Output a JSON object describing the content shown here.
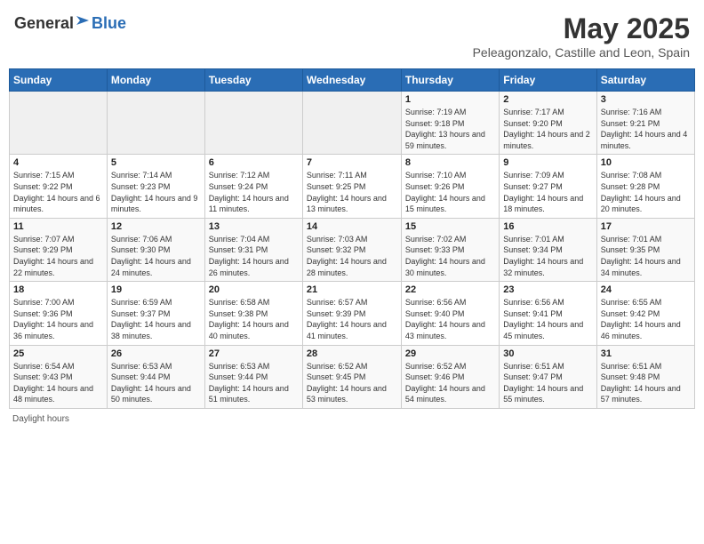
{
  "header": {
    "logo_general": "General",
    "logo_blue": "Blue",
    "month_title": "May 2025",
    "subtitle": "Peleagonzalo, Castille and Leon, Spain"
  },
  "days_of_week": [
    "Sunday",
    "Monday",
    "Tuesday",
    "Wednesday",
    "Thursday",
    "Friday",
    "Saturday"
  ],
  "weeks": [
    [
      {
        "day": "",
        "sunrise": "",
        "sunset": "",
        "daylight": ""
      },
      {
        "day": "",
        "sunrise": "",
        "sunset": "",
        "daylight": ""
      },
      {
        "day": "",
        "sunrise": "",
        "sunset": "",
        "daylight": ""
      },
      {
        "day": "",
        "sunrise": "",
        "sunset": "",
        "daylight": ""
      },
      {
        "day": "1",
        "sunrise": "Sunrise: 7:19 AM",
        "sunset": "Sunset: 9:18 PM",
        "daylight": "Daylight: 13 hours and 59 minutes."
      },
      {
        "day": "2",
        "sunrise": "Sunrise: 7:17 AM",
        "sunset": "Sunset: 9:20 PM",
        "daylight": "Daylight: 14 hours and 2 minutes."
      },
      {
        "day": "3",
        "sunrise": "Sunrise: 7:16 AM",
        "sunset": "Sunset: 9:21 PM",
        "daylight": "Daylight: 14 hours and 4 minutes."
      }
    ],
    [
      {
        "day": "4",
        "sunrise": "Sunrise: 7:15 AM",
        "sunset": "Sunset: 9:22 PM",
        "daylight": "Daylight: 14 hours and 6 minutes."
      },
      {
        "day": "5",
        "sunrise": "Sunrise: 7:14 AM",
        "sunset": "Sunset: 9:23 PM",
        "daylight": "Daylight: 14 hours and 9 minutes."
      },
      {
        "day": "6",
        "sunrise": "Sunrise: 7:12 AM",
        "sunset": "Sunset: 9:24 PM",
        "daylight": "Daylight: 14 hours and 11 minutes."
      },
      {
        "day": "7",
        "sunrise": "Sunrise: 7:11 AM",
        "sunset": "Sunset: 9:25 PM",
        "daylight": "Daylight: 14 hours and 13 minutes."
      },
      {
        "day": "8",
        "sunrise": "Sunrise: 7:10 AM",
        "sunset": "Sunset: 9:26 PM",
        "daylight": "Daylight: 14 hours and 15 minutes."
      },
      {
        "day": "9",
        "sunrise": "Sunrise: 7:09 AM",
        "sunset": "Sunset: 9:27 PM",
        "daylight": "Daylight: 14 hours and 18 minutes."
      },
      {
        "day": "10",
        "sunrise": "Sunrise: 7:08 AM",
        "sunset": "Sunset: 9:28 PM",
        "daylight": "Daylight: 14 hours and 20 minutes."
      }
    ],
    [
      {
        "day": "11",
        "sunrise": "Sunrise: 7:07 AM",
        "sunset": "Sunset: 9:29 PM",
        "daylight": "Daylight: 14 hours and 22 minutes."
      },
      {
        "day": "12",
        "sunrise": "Sunrise: 7:06 AM",
        "sunset": "Sunset: 9:30 PM",
        "daylight": "Daylight: 14 hours and 24 minutes."
      },
      {
        "day": "13",
        "sunrise": "Sunrise: 7:04 AM",
        "sunset": "Sunset: 9:31 PM",
        "daylight": "Daylight: 14 hours and 26 minutes."
      },
      {
        "day": "14",
        "sunrise": "Sunrise: 7:03 AM",
        "sunset": "Sunset: 9:32 PM",
        "daylight": "Daylight: 14 hours and 28 minutes."
      },
      {
        "day": "15",
        "sunrise": "Sunrise: 7:02 AM",
        "sunset": "Sunset: 9:33 PM",
        "daylight": "Daylight: 14 hours and 30 minutes."
      },
      {
        "day": "16",
        "sunrise": "Sunrise: 7:01 AM",
        "sunset": "Sunset: 9:34 PM",
        "daylight": "Daylight: 14 hours and 32 minutes."
      },
      {
        "day": "17",
        "sunrise": "Sunrise: 7:01 AM",
        "sunset": "Sunset: 9:35 PM",
        "daylight": "Daylight: 14 hours and 34 minutes."
      }
    ],
    [
      {
        "day": "18",
        "sunrise": "Sunrise: 7:00 AM",
        "sunset": "Sunset: 9:36 PM",
        "daylight": "Daylight: 14 hours and 36 minutes."
      },
      {
        "day": "19",
        "sunrise": "Sunrise: 6:59 AM",
        "sunset": "Sunset: 9:37 PM",
        "daylight": "Daylight: 14 hours and 38 minutes."
      },
      {
        "day": "20",
        "sunrise": "Sunrise: 6:58 AM",
        "sunset": "Sunset: 9:38 PM",
        "daylight": "Daylight: 14 hours and 40 minutes."
      },
      {
        "day": "21",
        "sunrise": "Sunrise: 6:57 AM",
        "sunset": "Sunset: 9:39 PM",
        "daylight": "Daylight: 14 hours and 41 minutes."
      },
      {
        "day": "22",
        "sunrise": "Sunrise: 6:56 AM",
        "sunset": "Sunset: 9:40 PM",
        "daylight": "Daylight: 14 hours and 43 minutes."
      },
      {
        "day": "23",
        "sunrise": "Sunrise: 6:56 AM",
        "sunset": "Sunset: 9:41 PM",
        "daylight": "Daylight: 14 hours and 45 minutes."
      },
      {
        "day": "24",
        "sunrise": "Sunrise: 6:55 AM",
        "sunset": "Sunset: 9:42 PM",
        "daylight": "Daylight: 14 hours and 46 minutes."
      }
    ],
    [
      {
        "day": "25",
        "sunrise": "Sunrise: 6:54 AM",
        "sunset": "Sunset: 9:43 PM",
        "daylight": "Daylight: 14 hours and 48 minutes."
      },
      {
        "day": "26",
        "sunrise": "Sunrise: 6:53 AM",
        "sunset": "Sunset: 9:44 PM",
        "daylight": "Daylight: 14 hours and 50 minutes."
      },
      {
        "day": "27",
        "sunrise": "Sunrise: 6:53 AM",
        "sunset": "Sunset: 9:44 PM",
        "daylight": "Daylight: 14 hours and 51 minutes."
      },
      {
        "day": "28",
        "sunrise": "Sunrise: 6:52 AM",
        "sunset": "Sunset: 9:45 PM",
        "daylight": "Daylight: 14 hours and 53 minutes."
      },
      {
        "day": "29",
        "sunrise": "Sunrise: 6:52 AM",
        "sunset": "Sunset: 9:46 PM",
        "daylight": "Daylight: 14 hours and 54 minutes."
      },
      {
        "day": "30",
        "sunrise": "Sunrise: 6:51 AM",
        "sunset": "Sunset: 9:47 PM",
        "daylight": "Daylight: 14 hours and 55 minutes."
      },
      {
        "day": "31",
        "sunrise": "Sunrise: 6:51 AM",
        "sunset": "Sunset: 9:48 PM",
        "daylight": "Daylight: 14 hours and 57 minutes."
      }
    ]
  ],
  "footer": {
    "daylight_label": "Daylight hours"
  },
  "colors": {
    "header_bg": "#2a6db5",
    "header_text": "#ffffff",
    "accent_blue": "#2a6db5"
  }
}
